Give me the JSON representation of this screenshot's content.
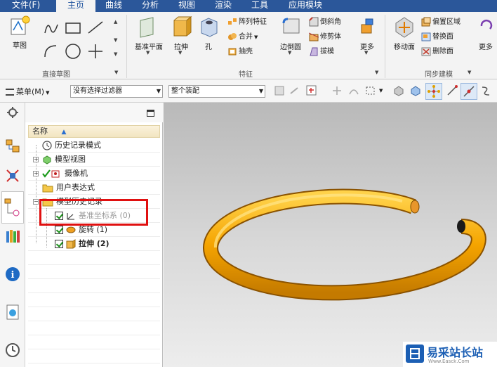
{
  "menu_tabs": [
    "文件(F)",
    "主页",
    "曲线",
    "分析",
    "视图",
    "渲染",
    "工具",
    "应用模块"
  ],
  "ribbon": {
    "groups": {
      "direct_sketch": "直接草图",
      "feature": "特征",
      "sync_modeling": "同步建模"
    },
    "sketch": "草图",
    "datum_plane": "基准平面",
    "extrude": "拉伸",
    "hole": "孔",
    "pattern_feature": "阵列特征",
    "unite": "合并",
    "shell": "抽壳",
    "edge_blend": "边倒圆",
    "chamfer": "倒斜角",
    "trim_body": "修剪体",
    "draft": "拔模",
    "more": "更多",
    "move_face": "移动面",
    "offset_region": "偏置区域",
    "replace_face": "替换面",
    "delete_face": "删除面",
    "more2": "更多"
  },
  "toolbar2": {
    "menu": "菜单(M)",
    "filter": "没有选择过滤器",
    "assembly": "整个装配"
  },
  "navigator": {
    "column_name": "名称",
    "items": [
      "历史记录模式",
      "模型视图",
      "摄像机",
      "用户表达式",
      "模型历史记录",
      "基准坐标系 (0)",
      "旋转 (1)",
      "拉伸 (2)"
    ]
  },
  "watermark": {
    "title": "易采站长站",
    "subtitle": "Www.Easck.Com"
  },
  "colors": {
    "tab_bar": "#2b579a",
    "torus": "#f5a400",
    "highlight_box": "#e01010"
  }
}
